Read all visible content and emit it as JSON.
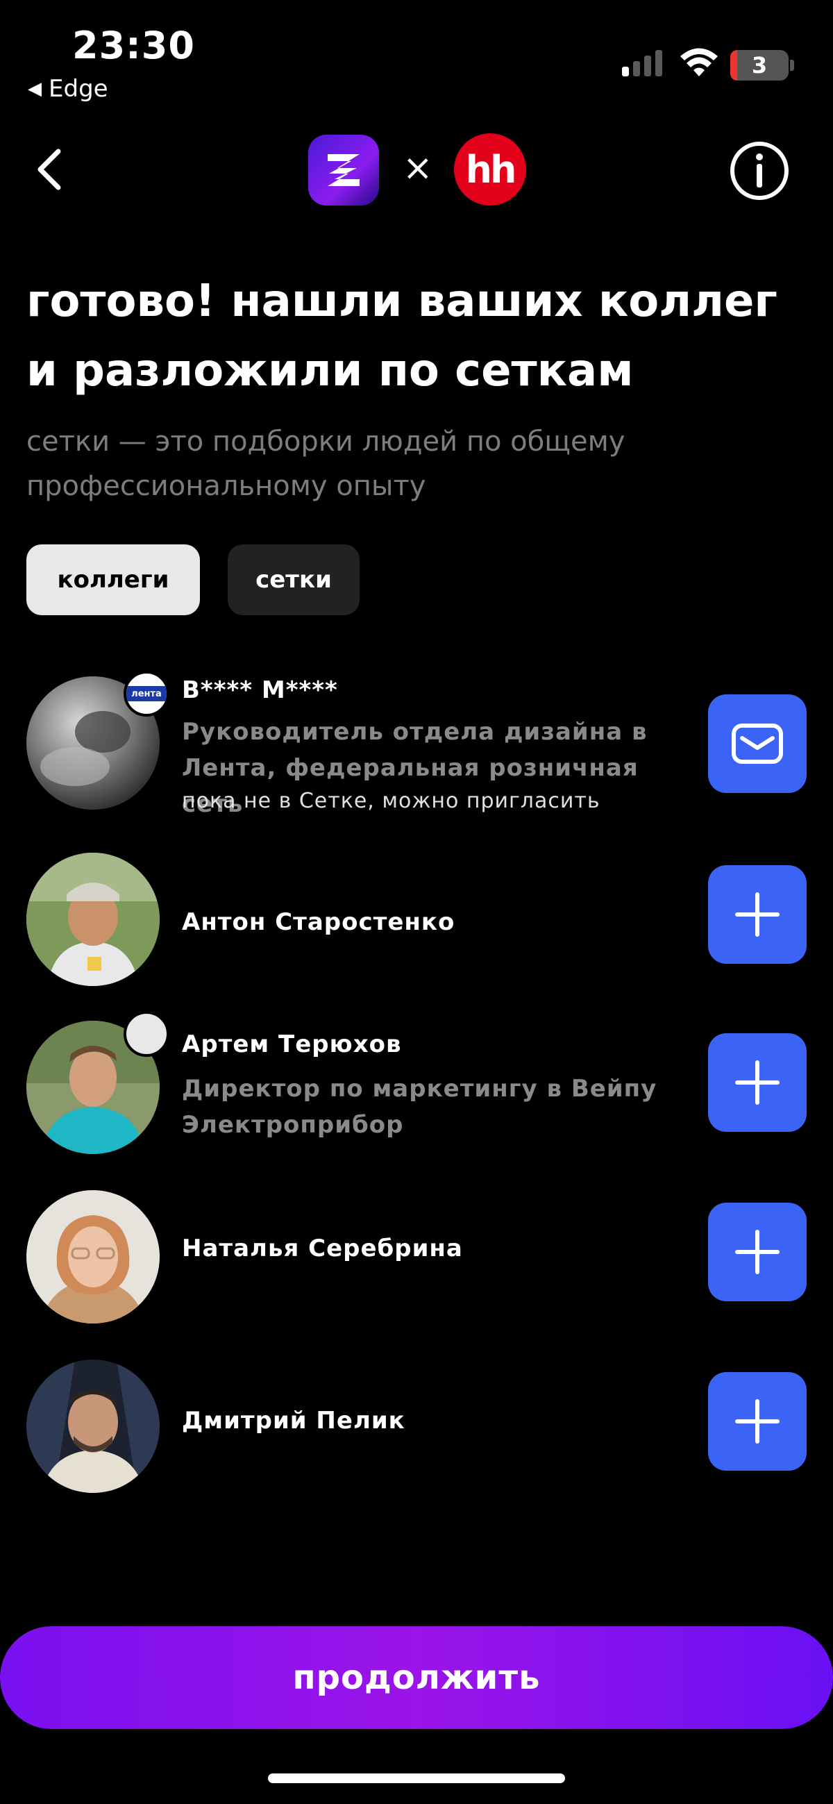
{
  "status_bar": {
    "time": "23:30",
    "back_app": "Edge",
    "battery_level": "3",
    "signal_bars_active": 1,
    "signal_bars_total": 4
  },
  "nav": {
    "partner_separator": "×",
    "partner_logo_text": "hh"
  },
  "header": {
    "title": "готово! нашли ваших коллег и разложили по сеткам",
    "subtitle": "сетки — это подборки людей по общему профессиональному опыту"
  },
  "tabs": [
    {
      "label": "коллеги",
      "active": true
    },
    {
      "label": "сетки",
      "active": false
    }
  ],
  "people": [
    {
      "name": "В**** М****",
      "position": "Руководитель отдела дизайна в Лента, федеральная розничная сеть",
      "note": "пока не в Сетке, можно пригласить",
      "action": "mail-icon",
      "company_badge": "лента"
    },
    {
      "name": "Антон Старостенко",
      "position": "",
      "note": "",
      "action": "plus-icon"
    },
    {
      "name": "Артем Терюхов",
      "position": "Директор по маркетингу в Вейпу Электроприбор",
      "note": "",
      "action": "plus-icon"
    },
    {
      "name": "Наталья Серебрина",
      "position": "",
      "note": "",
      "action": "plus-icon"
    },
    {
      "name": "Дмитрий Пелик",
      "position": "",
      "note": "",
      "action": "plus-icon"
    }
  ],
  "colors": {
    "accent_blue": "#3b63f5",
    "continue_gradient": [
      "#7a10f0",
      "#9b14e8"
    ],
    "hh_red": "#e3001b"
  },
  "continue_label": "продолжить"
}
